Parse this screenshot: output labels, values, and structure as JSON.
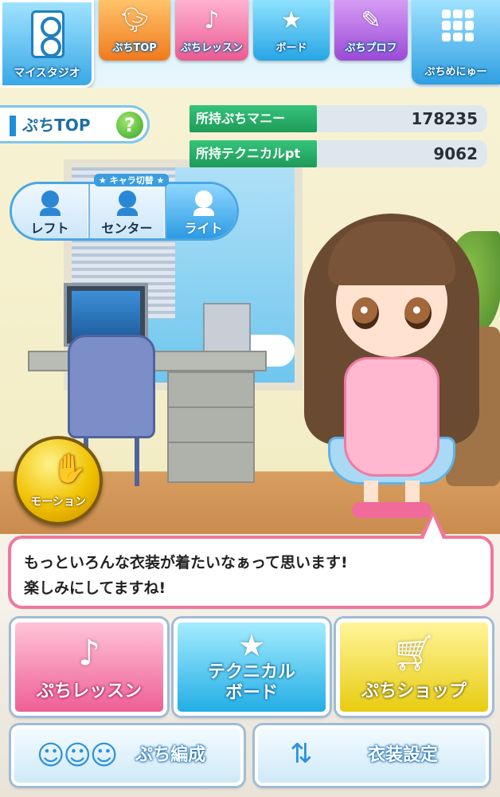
{
  "nav": {
    "studio": "マイスタジオ",
    "tabs": [
      {
        "label": "ぷちTOP",
        "icon": "bird-icon"
      },
      {
        "label": "ぷちレッスン",
        "icon": "music-note-icon"
      },
      {
        "label": "ボード",
        "icon": "star-icon"
      },
      {
        "label": "ぷちプロフ",
        "icon": "profile-note-icon"
      },
      {
        "label": "ぷちめにゅー",
        "icon": "grid-menu-icon"
      }
    ]
  },
  "page": {
    "title": "ぷちTOP",
    "help": "?"
  },
  "stats": [
    {
      "label": "所持ぷちマニー",
      "value": "178235"
    },
    {
      "label": "所持テクニカルpt",
      "value": "9062"
    }
  ],
  "chara_switch": {
    "title": "★ キャラ切替 ★",
    "options": [
      "レフト",
      "センター",
      "ライト"
    ],
    "selected": "ライト"
  },
  "motion": {
    "label": "モーション"
  },
  "dialogue": {
    "line1": "もっといろんな衣装が着たいなぁって思います!",
    "line2": "楽しみにしてますね!"
  },
  "menu": {
    "lesson": "ぷちレッスン",
    "board_line1": "テクニカル",
    "board_line2": "ボード",
    "shop": "ぷちショップ",
    "formation": "ぷち編成",
    "costume": "衣装設定"
  },
  "colors": {
    "accent_blue": "#2c9be3",
    "pink": "#ee5f95",
    "green_label": "#1f9a59",
    "gold": "#f1c100"
  }
}
